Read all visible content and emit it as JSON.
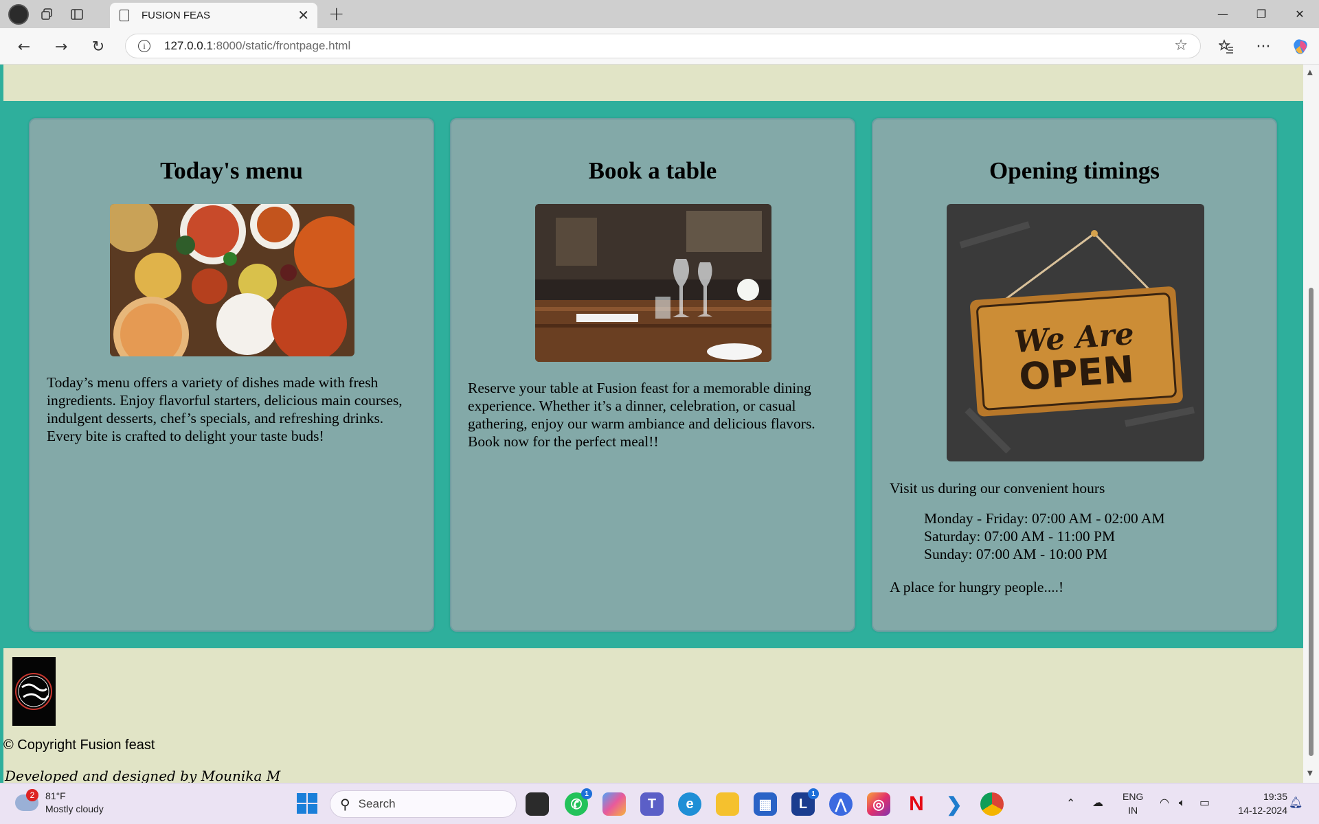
{
  "browser": {
    "tab_title": "FUSION FEAS",
    "url_host": "127.0.0.1",
    "url_rest": ":8000/static/frontpage.html"
  },
  "cards": [
    {
      "title": "Today's menu",
      "text": "Today’s menu offers a variety of dishes made with fresh ingredients. Enjoy flavorful starters, delicious main courses, indulgent desserts, chef’s specials, and refreshing drinks. Every bite is crafted to delight your taste buds!"
    },
    {
      "title": "Book a table",
      "text": "Reserve your table at Fusion feast for a memorable dining experience. Whether it’s a dinner, celebration, or casual gathering, enjoy our warm ambiance and delicious flavors. Book now for the perfect meal!!"
    },
    {
      "title": "Opening timings",
      "intro": "Visit us during our convenient hours",
      "hours": [
        "Monday - Friday: 07:00 AM - 02:00 AM",
        "Saturday: 07:00 AM - 11:00 PM",
        "Sunday: 07:00 AM - 10:00 PM"
      ],
      "tagline": "A place for hungry people....!",
      "sign_line1": "We Are",
      "sign_line2": "OPEN"
    }
  ],
  "footer": {
    "copyright": "© Copyright Fusion feast",
    "developer": "Developed and designed by Mounika M"
  },
  "taskbar": {
    "temperature": "81°F",
    "condition": "Mostly cloudy",
    "weather_badge": "2",
    "search_placeholder": "Search",
    "whatsapp_badge": "1",
    "l_app_badge": "1",
    "lang_line1": "ENG",
    "lang_line2": "IN",
    "time": "19:35",
    "date": "14-12-2024"
  },
  "colors": {
    "teal_background": "#2eaf9c",
    "card_background": "#83a9a8",
    "cream_band": "#e1e4c6"
  }
}
